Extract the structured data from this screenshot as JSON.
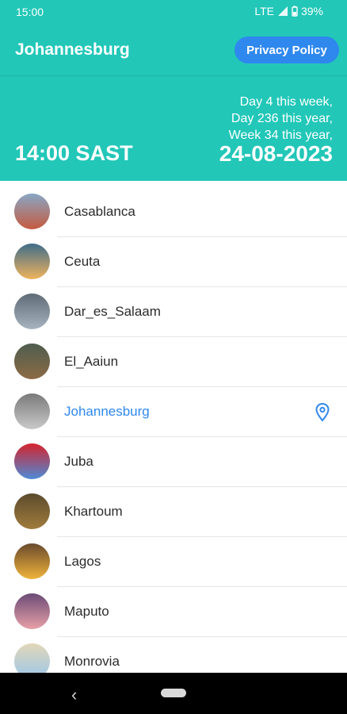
{
  "status_bar": {
    "time": "15:00",
    "network": "LTE",
    "battery": "39%"
  },
  "app_bar": {
    "title": "Johannesburg",
    "privacy_button": "Privacy Policy"
  },
  "header": {
    "time": "14:00 SAST",
    "day_week": "Day 4 this week,",
    "day_year": "Day 236 this year,",
    "week_year": "Week 34 this year,",
    "date": "24-08-2023"
  },
  "cities": [
    {
      "label": "Casablanca",
      "avatar_icon": "casablanca-photo-icon",
      "colors": [
        "#c65a3e",
        "#87a7c6"
      ]
    },
    {
      "label": "Ceuta",
      "avatar_icon": "ceuta-photo-icon",
      "colors": [
        "#f0b35d",
        "#3f6d89"
      ]
    },
    {
      "label": "Dar_es_Salaam",
      "avatar_icon": "dar-es-salaam-photo-icon",
      "colors": [
        "#a7b3bf",
        "#5f6c76"
      ]
    },
    {
      "label": "El_Aaiun",
      "avatar_icon": "el-aaiun-photo-icon",
      "colors": [
        "#8b6b45",
        "#4f5d4f"
      ]
    },
    {
      "label": "Johannesburg",
      "avatar_icon": "johannesburg-photo-icon",
      "colors": [
        "#c9c9c9",
        "#7a7a7a"
      ],
      "selected": true
    },
    {
      "label": "Juba",
      "avatar_icon": "juba-photo-icon",
      "colors": [
        "#4d8ad6",
        "#d5242e"
      ]
    },
    {
      "label": "Khartoum",
      "avatar_icon": "khartoum-photo-icon",
      "colors": [
        "#a17c3d",
        "#5b4b2d"
      ]
    },
    {
      "label": "Lagos",
      "avatar_icon": "lagos-photo-icon",
      "colors": [
        "#f0b43a",
        "#6a4a2e"
      ]
    },
    {
      "label": "Maputo",
      "avatar_icon": "maputo-photo-icon",
      "colors": [
        "#e7a0a7",
        "#6c4b77"
      ]
    },
    {
      "label": "Monrovia",
      "avatar_icon": "monrovia-photo-icon",
      "colors": [
        "#9cc7ea",
        "#e2d7b8"
      ]
    }
  ]
}
